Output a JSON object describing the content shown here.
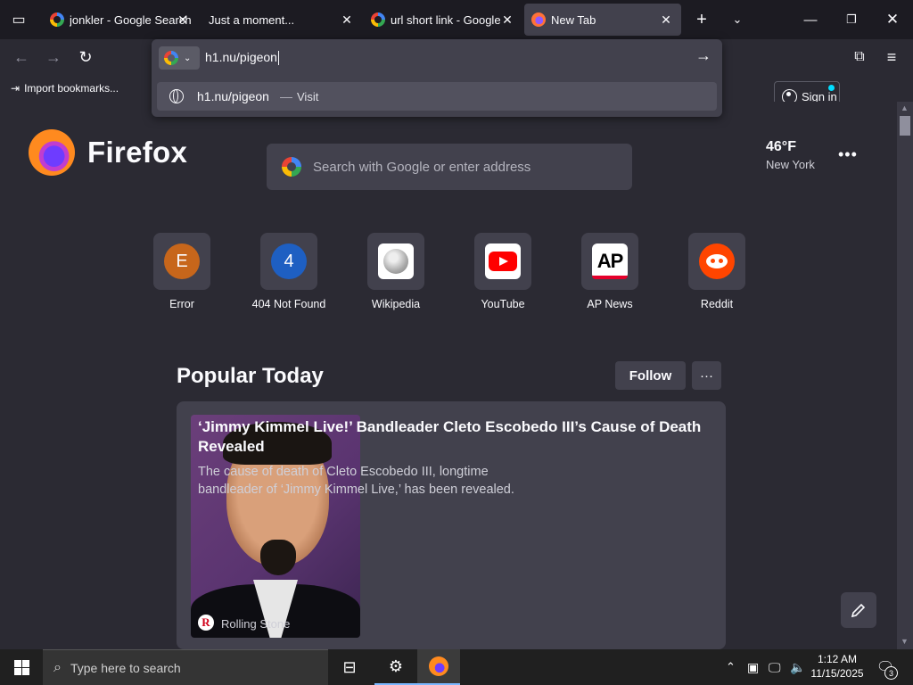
{
  "tabs": [
    {
      "title": "jonkler - Google Search",
      "icon": "google-icon",
      "active": false
    },
    {
      "title": "Just a moment...",
      "icon": "none",
      "active": false
    },
    {
      "title": "url short link - Google Se",
      "icon": "google-icon",
      "active": false
    },
    {
      "title": "New Tab",
      "icon": "firefox-icon",
      "active": true
    }
  ],
  "toolbar": {
    "url_value": "h1.nu/pigeon",
    "suggestion_url": "h1.nu/pigeon",
    "suggestion_separator": "—",
    "suggestion_action": "Visit",
    "signin_label": "Sign in",
    "import_bookmarks": "Import bookmarks..."
  },
  "newtab": {
    "brand": "Firefox",
    "search_placeholder": "Search with Google or enter address",
    "weather_temp": "46°F",
    "weather_city": "New York",
    "shortcuts": [
      {
        "label": "Error",
        "letter": "E",
        "color": "#c7661b"
      },
      {
        "label": "404 Not Found",
        "letter": "4",
        "color": "#1e5fc2"
      },
      {
        "label": "Wikipedia"
      },
      {
        "label": "YouTube"
      },
      {
        "label": "AP News",
        "letter": "AP"
      },
      {
        "label": "Reddit"
      }
    ],
    "popular_title": "Popular Today",
    "follow_label": "Follow",
    "story": {
      "title": "‘Jimmy Kimmel Live!’ Bandleader Cleto Escobedo III’s Cause of Death Revealed",
      "excerpt": "The cause of death of Cleto Escobedo III, longtime bandleader of ‘Jimmy Kimmel Live,’ has been revealed.",
      "source": "Rolling Stone",
      "source_initial": "R"
    }
  },
  "taskbar": {
    "search_placeholder": "Type here to search",
    "time": "1:12 AM",
    "date": "11/15/2025",
    "notification_count": "3"
  },
  "colors": {
    "tab_strip": "#1c1b22",
    "page_bg": "#2b2a33",
    "surface": "#42414d",
    "accent": "#00ddff"
  }
}
